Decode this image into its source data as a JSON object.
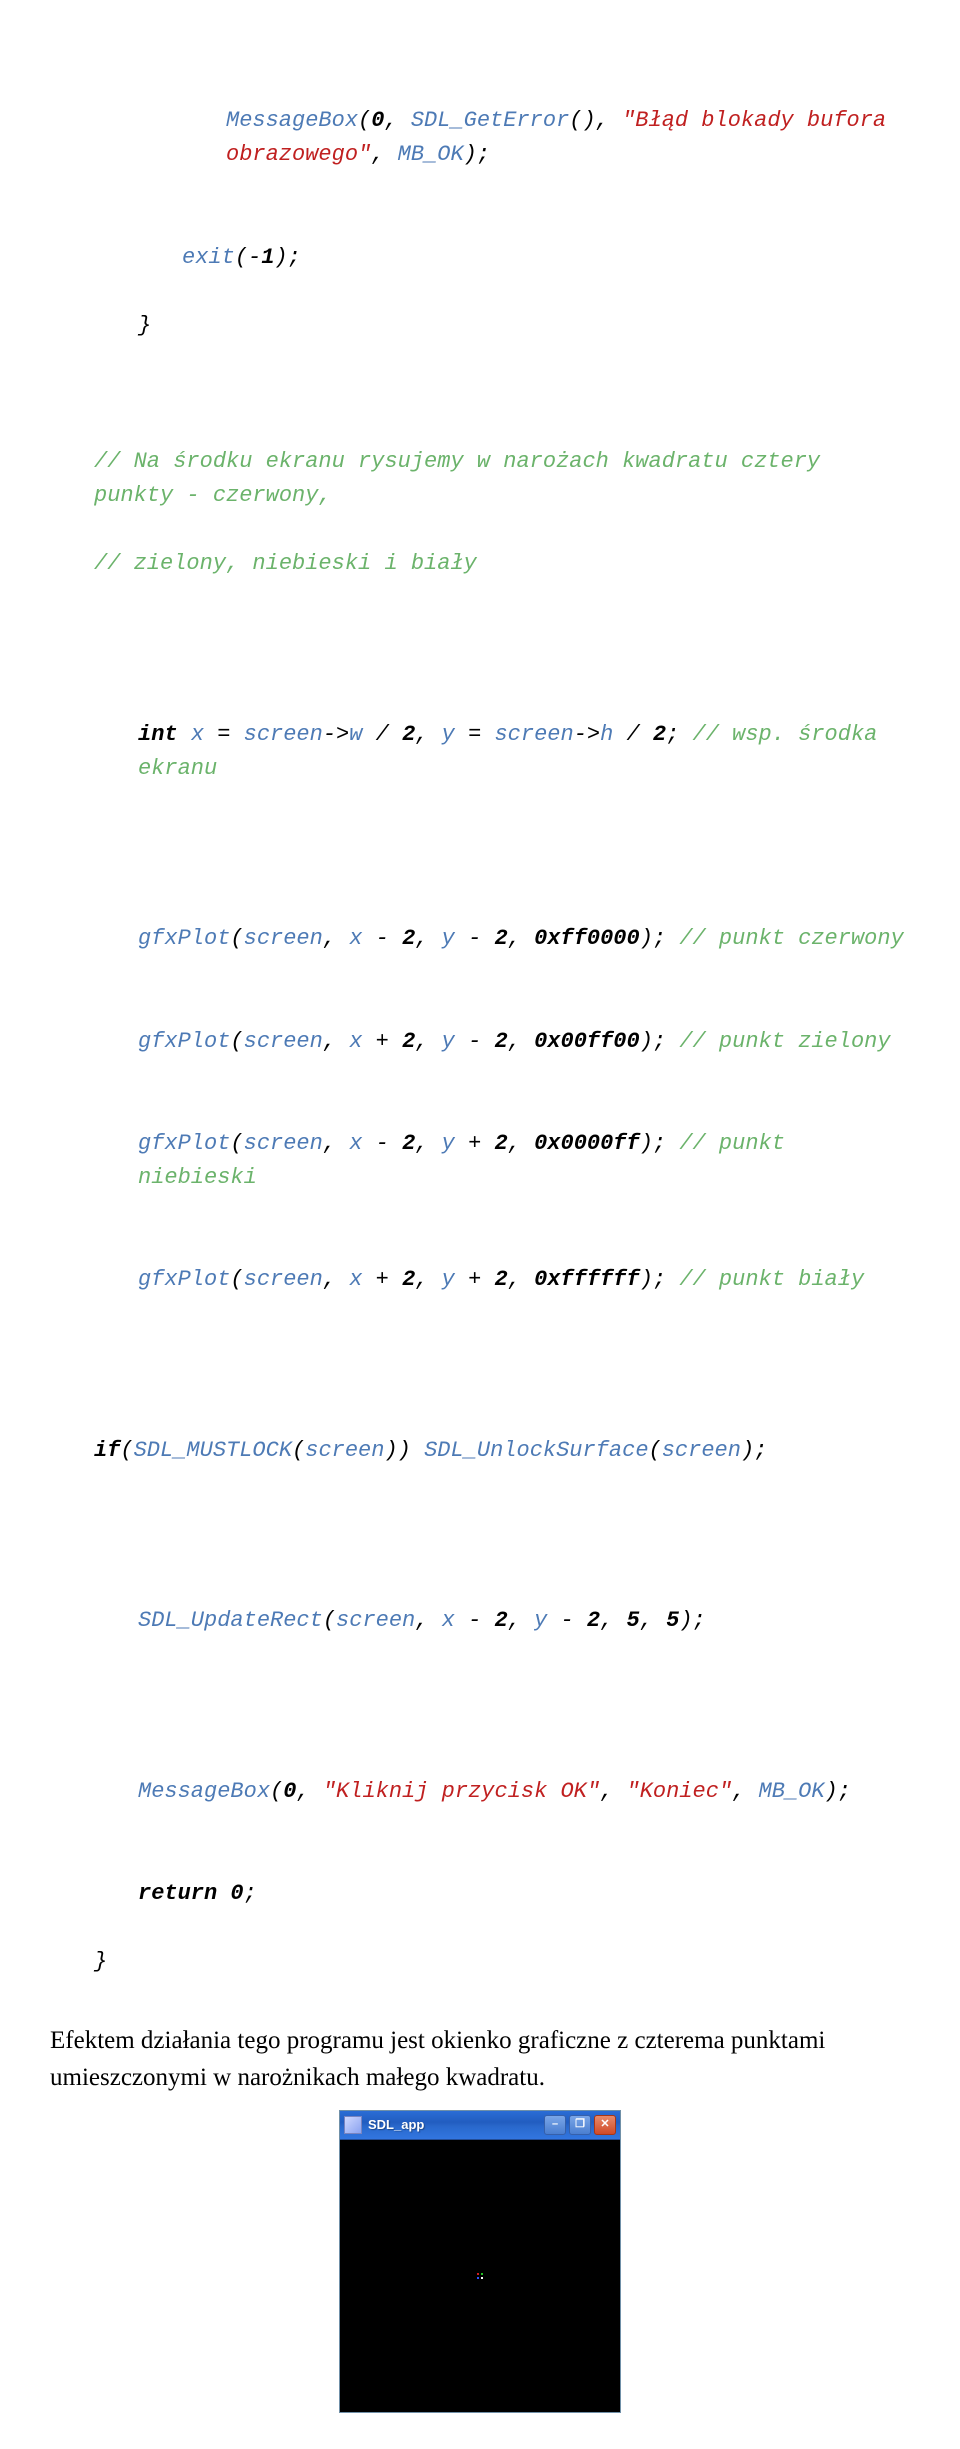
{
  "code": {
    "l1_a": "MessageBox",
    "l1_b": "(",
    "l1_c": "0",
    "l1_d": ", ",
    "l1_e": "SDL_GetError",
    "l1_f": "(), ",
    "l1_g": "\"Błąd blokady bufora obrazowego\"",
    "l1_h": ", ",
    "l1_i": "MB_OK",
    "l1_j": ");",
    "l2": "exit",
    "l2b": "(-",
    "l2c": "1",
    "l2d": ");",
    "l3": "}",
    "c1": "// Na środku ekranu rysujemy w narożach kwadratu cztery punkty - czerwony,",
    "c2": "// zielony, niebieski i biały",
    "l4a": "int",
    "l4b": " ",
    "l4c": "x",
    "l4d": " = ",
    "l4e": "screen",
    "l4f": "->",
    "l4g": "w",
    "l4h": " / ",
    "l4i": "2",
    "l4j": ", ",
    "l4k": "y",
    "l4l": " = ",
    "l4m": "screen",
    "l4n": "->",
    "l4o": "h",
    "l4p": " / ",
    "l4q": "2",
    "l4r": "; ",
    "l4s": "// wsp. środka ekranu",
    "p1a": "gfxPlot",
    "p1b": "(",
    "p1c": "screen",
    "p1d": ", ",
    "p1e": "x",
    "p1f": " - ",
    "p1g": "2",
    "p1h": ", ",
    "p1i": "y",
    "p1j": " - ",
    "p1k": "2",
    "p1l": ", ",
    "p1m": "0xff0000",
    "p1n": "); ",
    "p1o": "// punkt czerwony",
    "p2a": "gfxPlot",
    "p2b": "(",
    "p2c": "screen",
    "p2d": ", ",
    "p2e": "x",
    "p2f": " + ",
    "p2g": "2",
    "p2h": ", ",
    "p2i": "y",
    "p2j": " - ",
    "p2k": "2",
    "p2l": ", ",
    "p2m": "0x00ff00",
    "p2n": "); ",
    "p2o": "// punkt zielony",
    "p3a": "gfxPlot",
    "p3b": "(",
    "p3c": "screen",
    "p3d": ", ",
    "p3e": "x",
    "p3f": " - ",
    "p3g": "2",
    "p3h": ", ",
    "p3i": "y",
    "p3j": " + ",
    "p3k": "2",
    "p3l": ", ",
    "p3m": "0x0000ff",
    "p3n": "); ",
    "p3o": "// punkt niebieski",
    "p4a": "gfxPlot",
    "p4b": "(",
    "p4c": "screen",
    "p4d": ", ",
    "p4e": "x",
    "p4f": " + ",
    "p4g": "2",
    "p4h": ", ",
    "p4i": "y",
    "p4j": " + ",
    "p4k": "2",
    "p4l": ", ",
    "p4m": "0xffffff",
    "p4n": "); ",
    "p4o": "// punkt biały",
    "ifk": "if",
    "ifa": "(",
    "ifb": "SDL_MUSTLOCK",
    "ifc": "(",
    "ifd": "screen",
    "ife": ")) ",
    "unl": "SDL_UnlockSurface",
    "unl2": "(",
    "unl3": "screen",
    "unl4": ");",
    "ur1": "SDL_UpdateRect",
    "ur2": "(",
    "ur3": "screen",
    "ur4": ", ",
    "ur5": "x",
    "ur6": " - ",
    "ur7": "2",
    "ur8": ", ",
    "ur9": "y",
    "ur10": " - ",
    "ur11": "2",
    "ur12": ", ",
    "ur13": "5",
    "ur14": ", ",
    "ur15": "5",
    "ur16": ");",
    "mb1": "MessageBox",
    "mb2": "(",
    "mb3": "0",
    "mb4": ", ",
    "mb5": "\"Kliknij przycisk OK\"",
    "mb6": ", ",
    "mb7": "\"Koniec\"",
    "mb8": ", ",
    "mb9": "MB_OK",
    "mb10": ");",
    "ret1": "return",
    "ret2": " ",
    "ret3": "0",
    "ret4": ";",
    "end": "}"
  },
  "body_text": "Efektem działania tego programu jest okienko graficzne z czterema punktami umieszczonymi w narożnikach małego kwadratu.",
  "window": {
    "title": "SDL_app",
    "dots": {
      "red": "#d02020",
      "green": "#20c020",
      "blue": "#3050ff",
      "white": "#ffffff"
    }
  }
}
